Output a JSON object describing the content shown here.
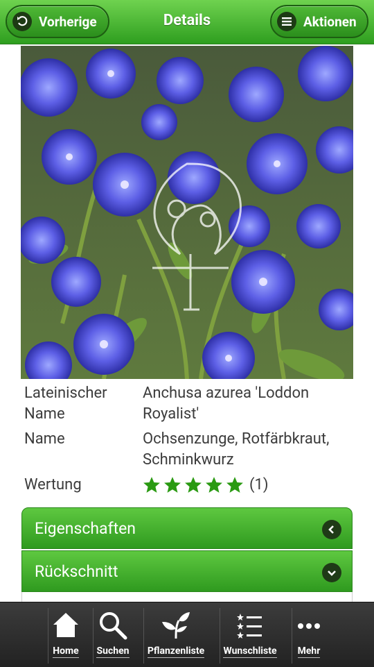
{
  "header": {
    "back_label": "Vorherige",
    "title": "Details",
    "actions_label": "Aktionen"
  },
  "plant": {
    "latin_label": "Lateinischer Name",
    "latin_value": "Anchusa azurea 'Loddon Royalist'",
    "name_label": "Name",
    "name_value": "Ochsenzunge, Rotfärbkraut, Schminkwurz",
    "rating_label": "Wertung",
    "rating_stars": 5,
    "rating_count": "(1)"
  },
  "sections": [
    {
      "label": "Eigenschaften",
      "icon": "chevron-left-icon"
    },
    {
      "label": "Rückschnitt",
      "icon": "chevron-down-icon"
    }
  ],
  "tabbar": {
    "items": [
      {
        "label": "Home",
        "icon": "home-icon"
      },
      {
        "label": "Suchen",
        "icon": "search-icon"
      },
      {
        "label": "Pflanzenliste",
        "icon": "plant-icon"
      },
      {
        "label": "Wunschliste",
        "icon": "star-list-icon"
      },
      {
        "label": "Mehr",
        "icon": "more-icon"
      }
    ]
  },
  "colors": {
    "brand_green": "#3aa829",
    "star_green": "#2a9a12"
  }
}
